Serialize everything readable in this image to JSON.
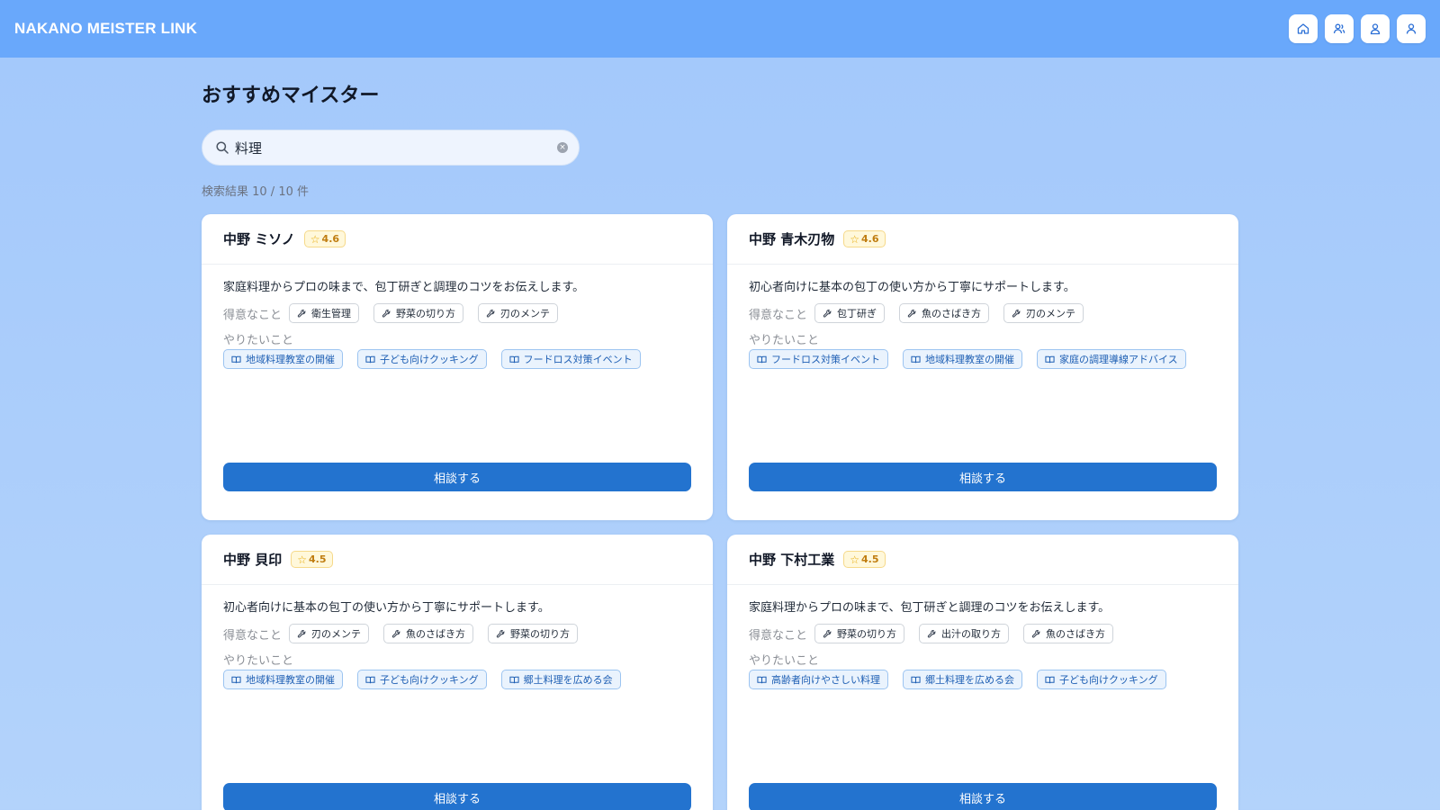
{
  "header": {
    "brand": "NAKANO MEISTER LINK",
    "nav": [
      {
        "icon": "home-icon"
      },
      {
        "icon": "users-icon"
      },
      {
        "icon": "user-icon"
      },
      {
        "icon": "profile-icon"
      }
    ]
  },
  "page": {
    "title": "おすすめマイスター",
    "search_value": "料理",
    "result_count": "検索結果 10 / 10 件"
  },
  "labels": {
    "skills": "得意なこと",
    "wants": "やりたいこと",
    "cta": "相談する"
  },
  "cards": [
    {
      "name": "中野 ミソノ",
      "rating": "4.6",
      "description": "家庭料理からプロの味まで、包丁研ぎと調理のコツをお伝えします。",
      "skills": [
        "衛生管理",
        "野菜の切り方",
        "刃のメンテ"
      ],
      "wants": [
        "地域料理教室の開催",
        "子ども向けクッキング",
        "フードロス対策イベント"
      ]
    },
    {
      "name": "中野 青木刃物",
      "rating": "4.6",
      "description": "初心者向けに基本の包丁の使い方から丁寧にサポートします。",
      "skills": [
        "包丁研ぎ",
        "魚のさばき方",
        "刃のメンテ"
      ],
      "wants": [
        "フードロス対策イベント",
        "地域料理教室の開催",
        "家庭の調理導線アドバイス"
      ]
    },
    {
      "name": "中野 貝印",
      "rating": "4.5",
      "description": "初心者向けに基本の包丁の使い方から丁寧にサポートします。",
      "skills": [
        "刃のメンテ",
        "魚のさばき方",
        "野菜の切り方"
      ],
      "wants": [
        "地域料理教室の開催",
        "子ども向けクッキング",
        "郷土料理を広める会"
      ]
    },
    {
      "name": "中野 下村工業",
      "rating": "4.5",
      "description": "家庭料理からプロの味まで、包丁研ぎと調理のコツをお伝えします。",
      "skills": [
        "野菜の切り方",
        "出汁の取り方",
        "魚のさばき方"
      ],
      "wants": [
        "高齢者向けやさしい料理",
        "郷土料理を広める会",
        "子ども向けクッキング"
      ]
    }
  ],
  "colors": {
    "topbar": "#69a8fb",
    "cta": "#2373cf",
    "goal_text": "#1e5fb4"
  }
}
